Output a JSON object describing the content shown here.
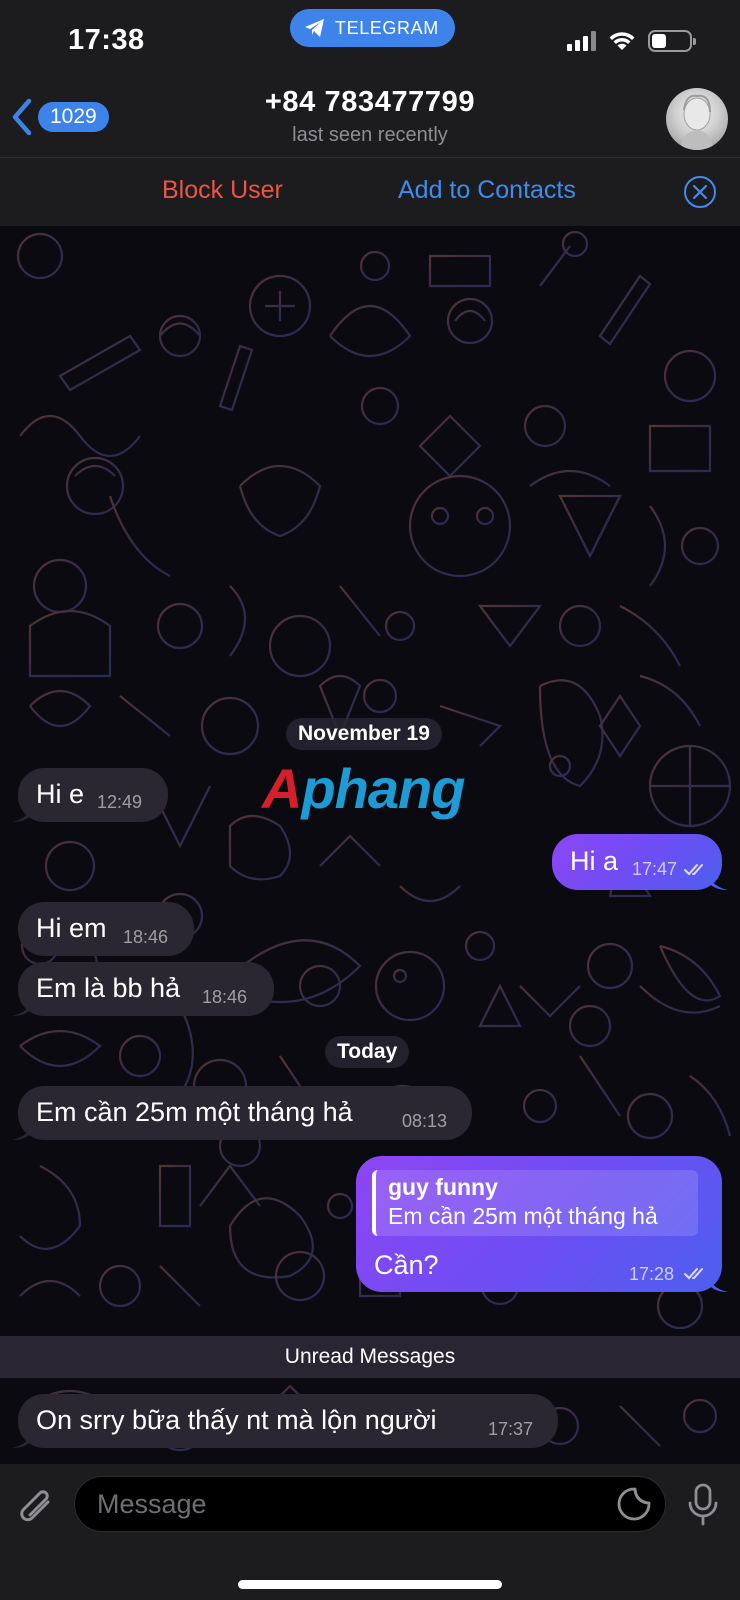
{
  "status_bar": {
    "time": "17:38",
    "app_pill": "TELEGRAM",
    "battery_level": 0.4
  },
  "header": {
    "back_count": "1029",
    "title": "+84 783477799",
    "subtitle": "last seen recently"
  },
  "action_bar": {
    "block_label": "Block User",
    "add_label": "Add to Contacts"
  },
  "messages": [
    {
      "date": "November 19"
    },
    {
      "direction": "in",
      "text": "Hi e",
      "time": "12:49"
    },
    {
      "direction": "out",
      "text": "Hi a",
      "time": "17:47",
      "status": "read"
    },
    {
      "direction": "in",
      "text": "Hi em",
      "time": "18:46"
    },
    {
      "direction": "in",
      "text": "Em là bb hả",
      "time": "18:46"
    },
    {
      "date": "Today"
    },
    {
      "direction": "in",
      "text": "Em cần 25m một tháng hả",
      "time": "08:13"
    },
    {
      "direction": "out",
      "text": "Cần?",
      "time": "17:28",
      "status": "read",
      "reply": {
        "name": "guy funny",
        "text": "Em cần 25m một tháng hả"
      }
    },
    {
      "divider": "Unread Messages"
    },
    {
      "direction": "in",
      "text": "On srry bữa thấy nt mà lộn người",
      "time": "17:37"
    }
  ],
  "watermark": {
    "part1": "A",
    "part2": "phang"
  },
  "input": {
    "placeholder": "Message"
  },
  "colors": {
    "accent": "#3e83ea",
    "danger": "#eb5545",
    "incoming_bubble": "#2a2632",
    "outgoing_gradient_start": "#8d45f5",
    "outgoing_gradient_end": "#4d5ff0"
  },
  "icons": [
    "telegram-icon",
    "signal-icon",
    "wifi-icon",
    "battery-icon",
    "back-chevron-icon",
    "close-icon",
    "double-check-icon",
    "attach-icon",
    "sticker-icon",
    "microphone-icon"
  ]
}
